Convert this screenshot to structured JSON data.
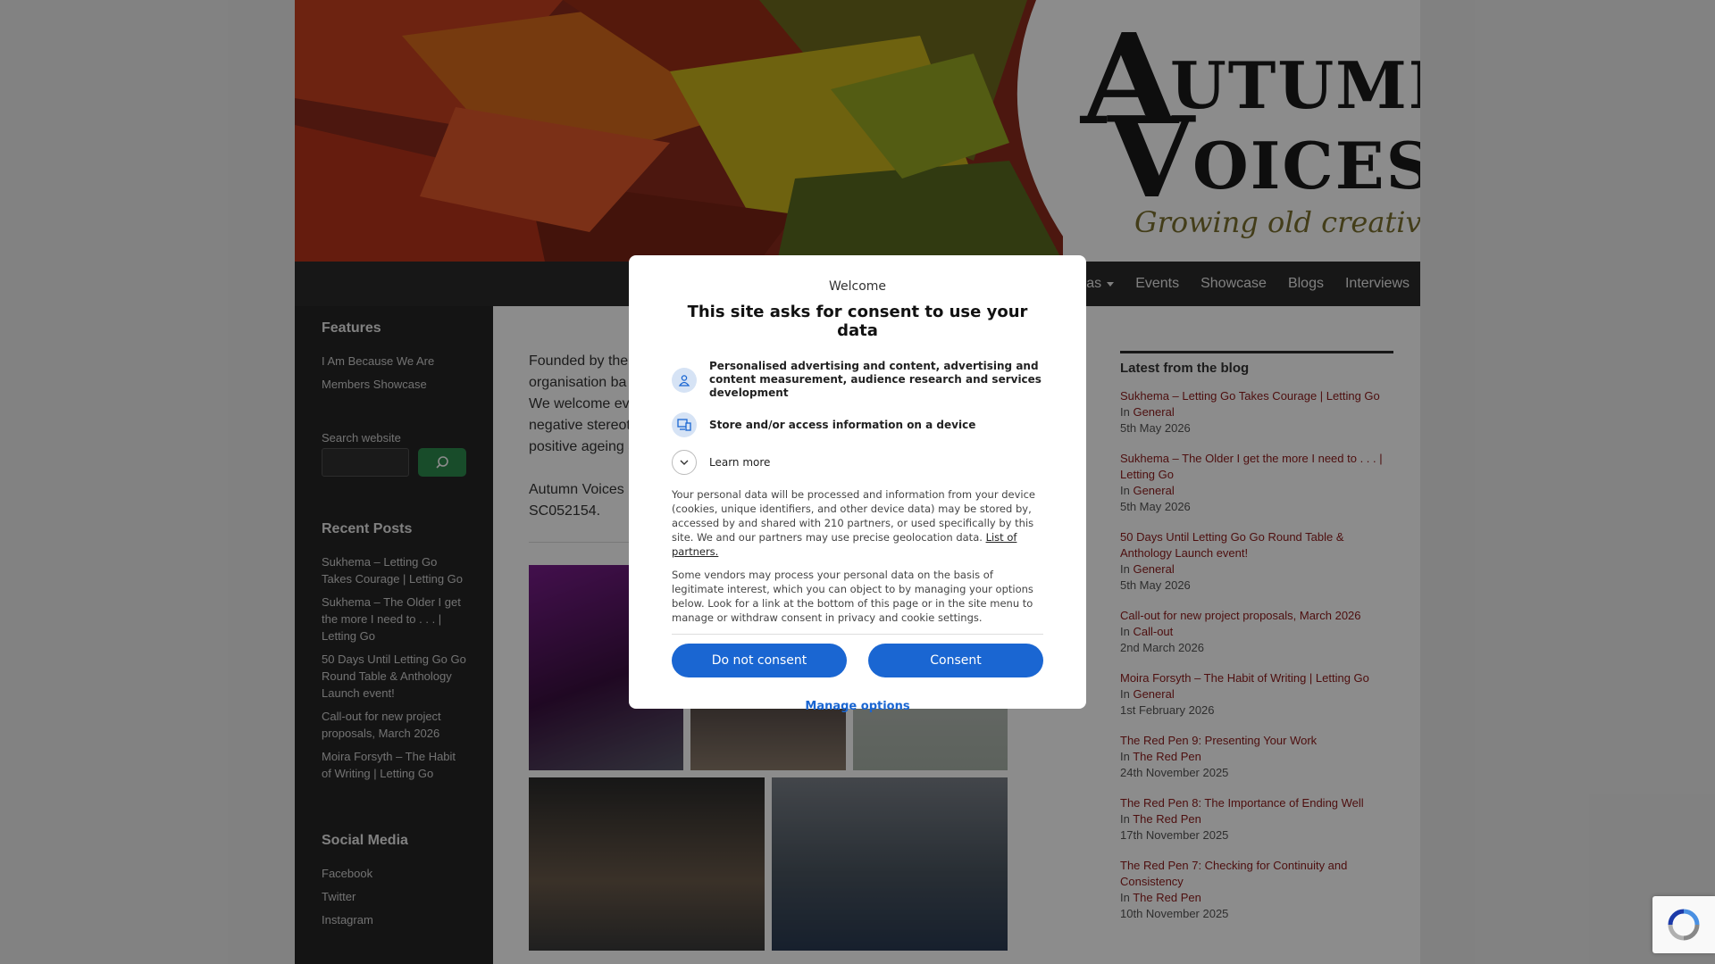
{
  "header": {
    "logo_line1_initial": "A",
    "logo_line1_rest": "UTUMN",
    "logo_line2_initial": "V",
    "logo_line2_rest": "OICES",
    "tagline": "Growing old creatively"
  },
  "nav": {
    "items": [
      {
        "label": "as",
        "has_caret": true
      },
      {
        "label": "Events"
      },
      {
        "label": "Showcase"
      },
      {
        "label": "Blogs"
      },
      {
        "label": "Interviews"
      }
    ]
  },
  "left_sidebar": {
    "features_heading": "Features",
    "features": [
      "I Am Because We Are",
      "Members Showcase"
    ],
    "search_label": "Search website",
    "recent_heading": "Recent Posts",
    "recent": [
      "Sukhema – Letting Go Takes Courage | Letting Go",
      "Sukhema – The Older I get the more I need to . . . | Letting Go",
      "50 Days Until Letting Go Go Round Table & Anthology Launch event!",
      "Call-out for new project proposals, March 2026",
      "Moira Forsyth – The Habit of Writing | Letting Go"
    ],
    "social_heading": "Social Media",
    "social": [
      "Facebook",
      "Twitter",
      "Instagram"
    ]
  },
  "main": {
    "para1_lines": [
      "Founded by the",
      "organisation ba",
      "We welcome ev",
      "negative stereot",
      "positive ageing a"
    ],
    "para2_lines": [
      "Autumn Voices i",
      "SC052154."
    ]
  },
  "right_sidebar": {
    "heading": "Latest from the blog",
    "in_label": "In",
    "posts": [
      {
        "title": "Sukhema – Letting Go Takes Courage | Letting Go",
        "category": "General",
        "date": "5th May 2026"
      },
      {
        "title": "Sukhema – The Older I get the more I need to . . . | Letting Go",
        "category": "General",
        "date": "5th May 2026"
      },
      {
        "title": "50 Days Until Letting Go Go Round Table & Anthology Launch event!",
        "category": "General",
        "date": "5th May 2026"
      },
      {
        "title": "Call-out for new project proposals, March 2026",
        "category": "Call-out",
        "date": "2nd March 2026"
      },
      {
        "title": "Moira Forsyth – The Habit of Writing | Letting Go",
        "category": "General",
        "date": "1st February 2026"
      },
      {
        "title": "The Red Pen 9: Presenting Your Work",
        "category": "The Red Pen",
        "date": "24th November 2025"
      },
      {
        "title": "The Red Pen 8: The Importance of Ending Well",
        "category": "The Red Pen",
        "date": "17th November 2025"
      },
      {
        "title": "The Red Pen 7: Checking for Continuity and Consistency",
        "category": "The Red Pen",
        "date": "10th November 2025"
      }
    ]
  },
  "consent": {
    "welcome": "Welcome",
    "title": "This site asks for consent to use your data",
    "purpose1": "Personalised advertising and content, advertising and content measurement, audience research and services development",
    "purpose2": "Store and/or access information on a device",
    "learn_more": "Learn more",
    "body1": "Your personal data will be processed and information from your device (cookies, unique identifiers, and other device data) may be stored by, accessed by and shared with 210 partners, or used specifically by this site. We and our partners may use precise geolocation data.",
    "partners_link": "List of partners.",
    "body2": "Some vendors may process your personal data on the basis of legitimate interest, which you can object to by managing your options below. Look for a link at the bottom of this page or in the site menu to manage or withdraw consent in privacy and cookie settings.",
    "do_not_consent": "Do not consent",
    "consent": "Consent",
    "manage_options": "Manage options"
  },
  "colors": {
    "accent_blue": "#1a66d2",
    "link_red": "#8c1a1a",
    "sidebar_dark": "#262626",
    "search_green": "#2d8a4e"
  },
  "icons": {
    "person": "person-icon",
    "device": "device-icon",
    "chevron": "chevron-down-icon",
    "search": "search-icon",
    "recaptcha": "recaptcha-icon"
  }
}
